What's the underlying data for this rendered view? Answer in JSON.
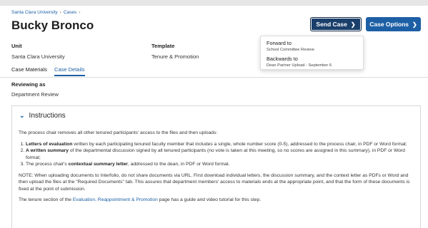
{
  "breadcrumb": {
    "items": [
      "Santa Clara University",
      "Cases"
    ],
    "separator": "›"
  },
  "header": {
    "title": "Bucky Bronco"
  },
  "buttons": {
    "send_case": "Send Case",
    "case_options": "Case Options"
  },
  "send_menu": {
    "items": [
      {
        "label": "Forward to",
        "sublabel": "School Committee Review"
      },
      {
        "label": "Backwards to",
        "sublabel": "Dean Partner Upload - September 6"
      }
    ]
  },
  "fields": {
    "unit": {
      "label": "Unit",
      "value": "Santa Clara University"
    },
    "template": {
      "label": "Template",
      "value": "Tenure & Promotion"
    }
  },
  "tabs": [
    {
      "label": "Case Materials",
      "active": false
    },
    {
      "label": "Case Details",
      "active": true
    }
  ],
  "reviewing": {
    "label": "Reviewing as",
    "value": "Department Review"
  },
  "instructions": {
    "heading": "Instructions",
    "intro": "The process chair removes all other tenured participants' access to the files and then uploads:",
    "list": [
      {
        "bold": "Letters of evaluation",
        "rest": " written by each participating tenured faculty member that includes a single, whole number score (0-5), addressed to the process chair, in PDF or Word format;"
      },
      {
        "bold": "A written summary",
        "rest": " of the departmental discussion signed by all tenured participants (no vote is taken at this meeting, so no scores are assigned in this summary), in PDF or Word format;"
      },
      {
        "pre": "The process chair's ",
        "bold": "contextual summary letter",
        "rest": ", addressed to the dean, in PDF or Word format."
      }
    ],
    "note": "NOTE: When uploading documents to Interfolio, do not share documents via URL. First download individual letters, the discussion summary, and the context letter as PDFs or Word and then upload the files at the \"Required Documents\" tab. This assures that department members' access to materials ends at the appropriate point, and that the form of these documents is fixed at the point of submission.",
    "footer_pre": "The tenure section of the ",
    "footer_link": "Evaluation, Reappointment & Promotion",
    "footer_post": " page has a guide and video tutorial for this step."
  },
  "icons": {
    "chevron": "chevron-down-icon"
  },
  "colors": {
    "primary": "#1d5fa5",
    "send_button": "#1a3f6b"
  }
}
